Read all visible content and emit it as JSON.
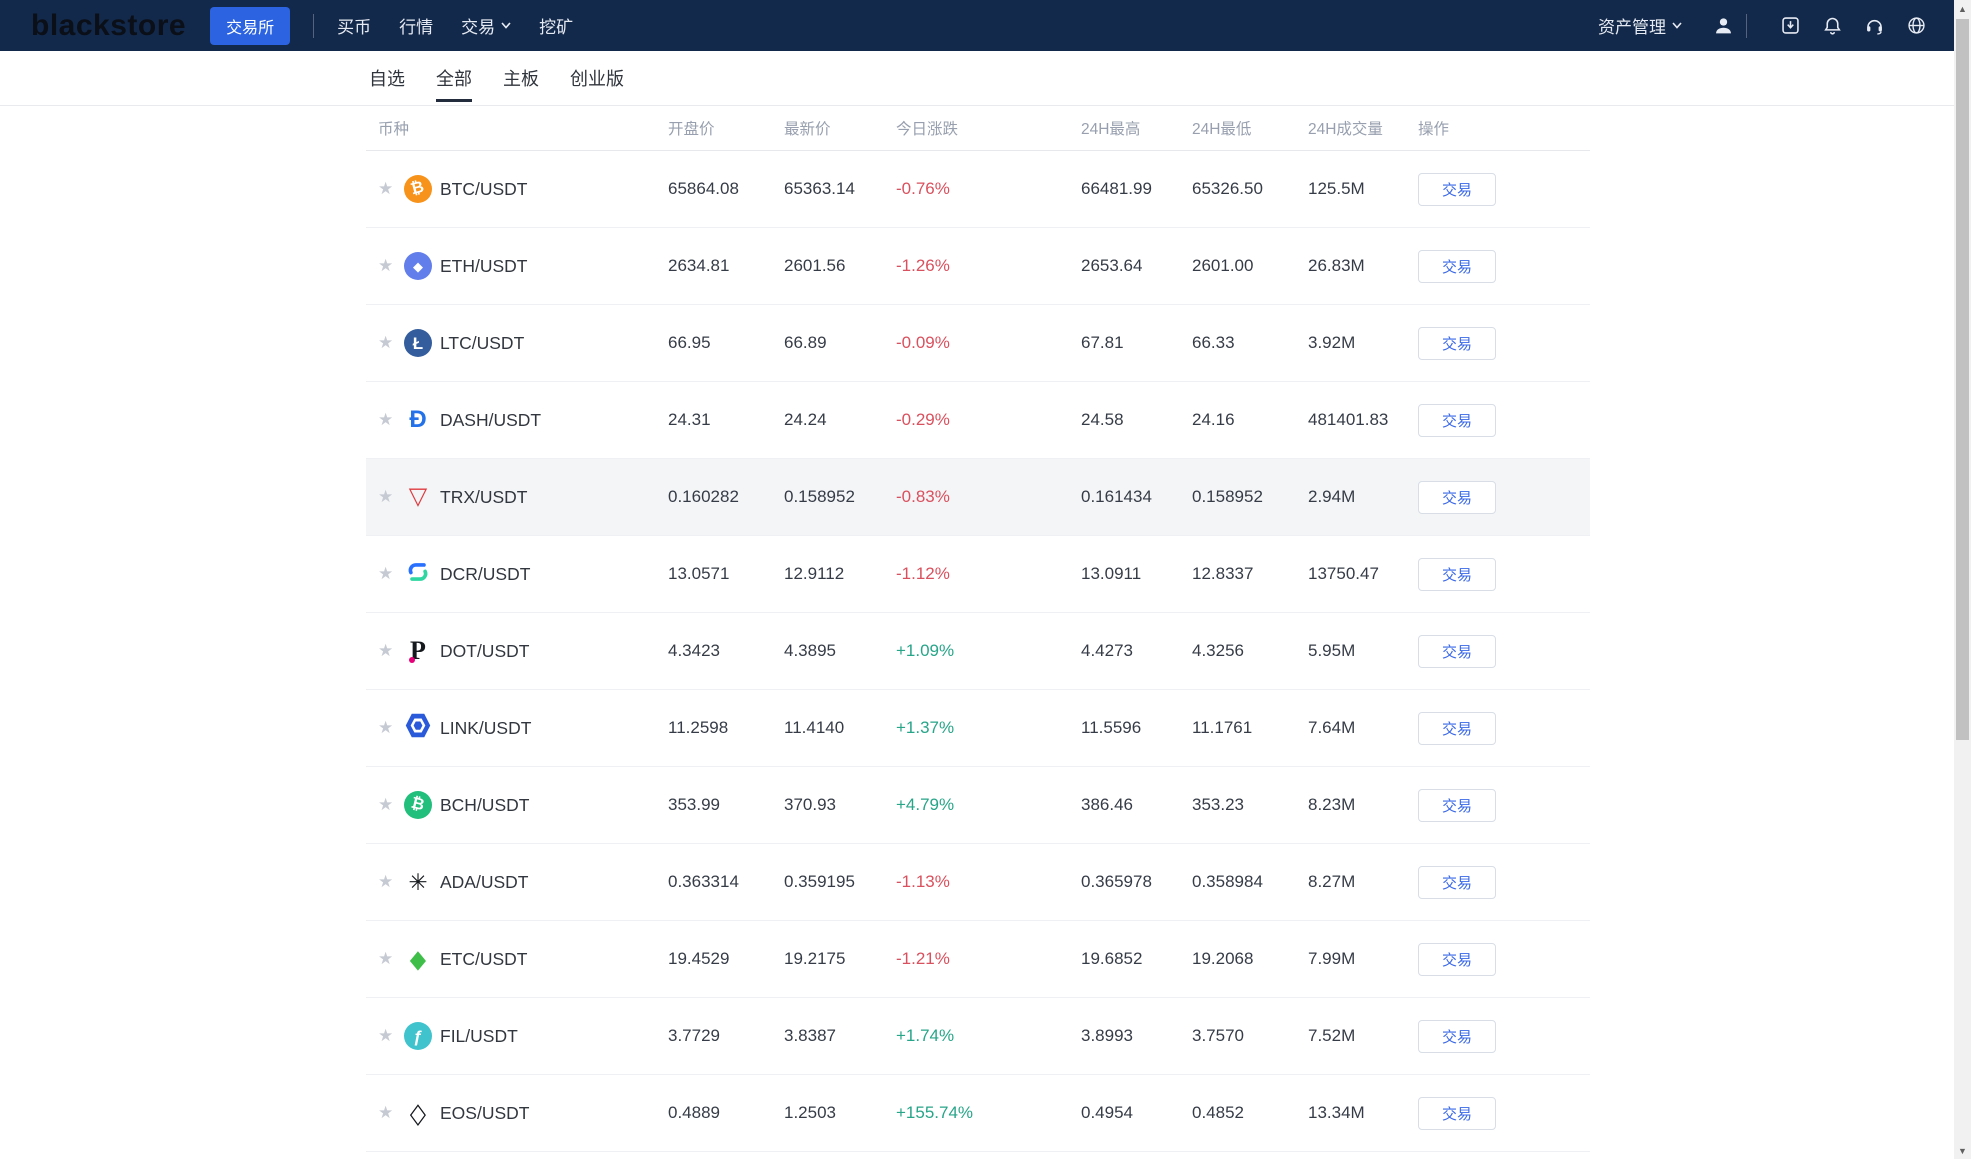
{
  "navbar": {
    "logo": "blackstore",
    "exchange_button": "交易所",
    "items": [
      "买币",
      "行情",
      "交易",
      "挖矿"
    ],
    "asset_menu": "资产管理"
  },
  "tabs": [
    {
      "label": "自选",
      "active": false
    },
    {
      "label": "全部",
      "active": true
    },
    {
      "label": "主板",
      "active": false
    },
    {
      "label": "创业版",
      "active": false
    }
  ],
  "table": {
    "headers": [
      "币种",
      "开盘价",
      "最新价",
      "今日涨跌",
      "24H最高",
      "24H最低",
      "24H成交量",
      "操作"
    ],
    "trade_button_label": "交易",
    "rows": [
      {
        "pair": "BTC/USDT",
        "open": "65864.08",
        "last": "65363.14",
        "change": "-0.76%",
        "direction": "down",
        "high": "66481.99",
        "low": "65326.50",
        "volume": "125.5M",
        "highlight": false,
        "icon": {
          "name": "btc-icon",
          "shape": "circle",
          "bg": "#F7931A",
          "fg": "#ffffff",
          "glyph": "₿",
          "size": 16,
          "tilt": -15
        }
      },
      {
        "pair": "ETH/USDT",
        "open": "2634.81",
        "last": "2601.56",
        "change": "-1.26%",
        "direction": "down",
        "high": "2653.64",
        "low": "2601.00",
        "volume": "26.83M",
        "highlight": false,
        "icon": {
          "name": "eth-icon",
          "shape": "circle",
          "bg": "#627EEA",
          "fg": "#ffffff",
          "glyph": "◆",
          "size": 13
        }
      },
      {
        "pair": "LTC/USDT",
        "open": "66.95",
        "last": "66.89",
        "change": "-0.09%",
        "direction": "down",
        "high": "67.81",
        "low": "66.33",
        "volume": "3.92M",
        "highlight": false,
        "icon": {
          "name": "ltc-icon",
          "shape": "circle",
          "bg": "#345D9D",
          "fg": "#ffffff",
          "glyph": "Ł",
          "size": 17
        }
      },
      {
        "pair": "DASH/USDT",
        "open": "24.31",
        "last": "24.24",
        "change": "-0.29%",
        "direction": "down",
        "high": "24.58",
        "low": "24.16",
        "volume": "481401.83",
        "highlight": false,
        "icon": {
          "name": "dash-icon",
          "shape": "plain",
          "fg": "#2472E9",
          "glyph": "Đ",
          "size": 24
        }
      },
      {
        "pair": "TRX/USDT",
        "open": "0.160282",
        "last": "0.158952",
        "change": "-0.83%",
        "direction": "down",
        "high": "0.161434",
        "low": "0.158952",
        "volume": "2.94M",
        "highlight": true,
        "icon": {
          "name": "trx-icon",
          "shape": "plain",
          "fg": "#DF3A3F",
          "glyph": "▽",
          "size": 24
        }
      },
      {
        "pair": "DCR/USDT",
        "open": "13.0571",
        "last": "12.9112",
        "change": "-1.12%",
        "direction": "down",
        "high": "13.0911",
        "low": "12.8337",
        "volume": "13750.47",
        "highlight": false,
        "icon": {
          "name": "dcr-icon",
          "shape": "dcr",
          "blue": "#2970FF",
          "green": "#2ED6A1"
        }
      },
      {
        "pair": "DOT/USDT",
        "open": "4.3423",
        "last": "4.3895",
        "change": "+1.09%",
        "direction": "up",
        "high": "4.4273",
        "low": "4.3256",
        "volume": "5.95M",
        "highlight": false,
        "icon": {
          "name": "dot-icon",
          "shape": "dotp"
        }
      },
      {
        "pair": "LINK/USDT",
        "open": "11.2598",
        "last": "11.4140",
        "change": "+1.37%",
        "direction": "up",
        "high": "11.5596",
        "low": "11.1761",
        "volume": "7.64M",
        "highlight": false,
        "icon": {
          "name": "link-icon",
          "shape": "hex",
          "bg": "#2A5ADA"
        }
      },
      {
        "pair": "BCH/USDT",
        "open": "353.99",
        "last": "370.93",
        "change": "+4.79%",
        "direction": "up",
        "high": "386.46",
        "low": "353.23",
        "volume": "8.23M",
        "highlight": false,
        "icon": {
          "name": "bch-icon",
          "shape": "circle",
          "bg": "#22BE7C",
          "fg": "#ffffff",
          "glyph": "₿",
          "size": 16,
          "tilt": 14
        }
      },
      {
        "pair": "ADA/USDT",
        "open": "0.363314",
        "last": "0.359195",
        "change": "-1.13%",
        "direction": "down",
        "high": "0.365978",
        "low": "0.358984",
        "volume": "8.27M",
        "highlight": false,
        "icon": {
          "name": "ada-icon",
          "shape": "plain",
          "fg": "#16191D",
          "glyph": "✳",
          "size": 23
        }
      },
      {
        "pair": "ETC/USDT",
        "open": "19.4529",
        "last": "19.2175",
        "change": "-1.21%",
        "direction": "down",
        "high": "19.6852",
        "low": "19.2068",
        "volume": "7.99M",
        "highlight": false,
        "icon": {
          "name": "etc-icon",
          "shape": "plain",
          "fg": "#3FBF49",
          "glyph": "◆",
          "size": 21,
          "stretch": 1.2
        }
      },
      {
        "pair": "FIL/USDT",
        "open": "3.7729",
        "last": "3.8387",
        "change": "+1.74%",
        "direction": "up",
        "high": "3.8993",
        "low": "3.7570",
        "volume": "7.52M",
        "highlight": false,
        "icon": {
          "name": "fil-icon",
          "shape": "circle",
          "bg": "#41C3CD",
          "fg": "#ffffff",
          "glyph": "ƒ",
          "size": 17
        }
      },
      {
        "pair": "EOS/USDT",
        "open": "0.4889",
        "last": "1.2503",
        "change": "+155.74%",
        "direction": "up",
        "high": "0.4954",
        "low": "0.4852",
        "volume": "13.34M",
        "highlight": false,
        "icon": {
          "name": "eos-icon",
          "shape": "plain",
          "fg": "#14171C",
          "glyph": "◇",
          "size": 21,
          "stretch": 1.35
        }
      }
    ]
  },
  "colors": {
    "navbar_bg": "#13294B",
    "accent_blue": "#2B63E0",
    "up_green": "#27A588",
    "down_red": "#D9515E"
  }
}
